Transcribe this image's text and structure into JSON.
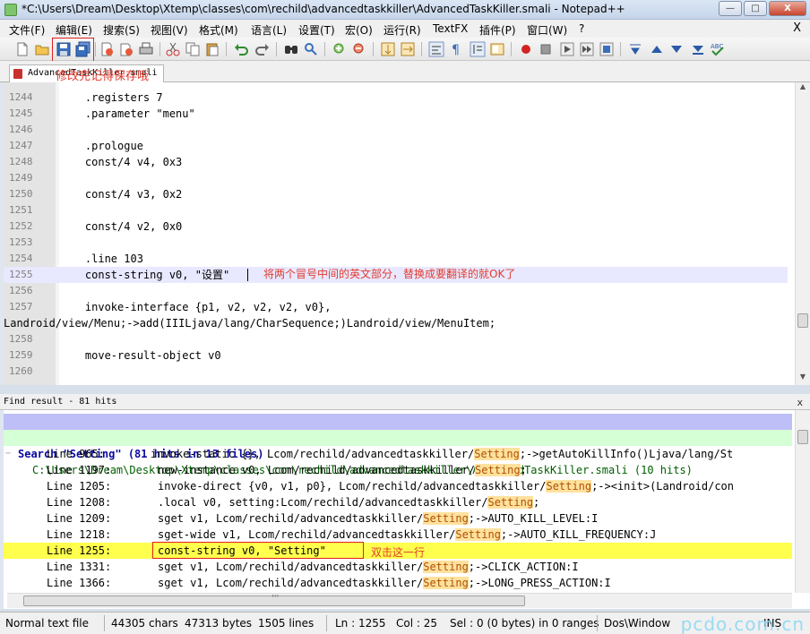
{
  "window": {
    "title": "*C:\\Users\\Dream\\Desktop\\Xtemp\\classes\\com\\rechild\\advancedtaskkiller\\AdvancedTaskKiller.smali - Notepad++",
    "minimize": "—",
    "maximize": "□",
    "close": "X"
  },
  "menu": {
    "items": [
      "文件(F)",
      "编辑(E)",
      "搜索(S)",
      "视图(V)",
      "格式(M)",
      "语言(L)",
      "设置(T)",
      "宏(O)",
      "运行(R)",
      "TextFX",
      "插件(P)",
      "窗口(W)",
      "?"
    ],
    "close": "X"
  },
  "toolbar": {
    "icons": [
      "new-file-icon",
      "open-file-icon",
      "save-icon",
      "save-all-icon",
      "close-icon",
      "close-all-icon",
      "print-icon",
      "cut-icon",
      "copy-icon",
      "paste-icon",
      "undo-icon",
      "redo-icon",
      "find-icon",
      "replace-icon",
      "zoom-in-icon",
      "zoom-out-icon",
      "sync-v-icon",
      "sync-h-icon",
      "word-wrap-icon",
      "show-all-icon",
      "indent-guide-icon",
      "doc-map-icon",
      "record-macro-icon",
      "stop-macro-icon",
      "play-macro-icon",
      "run-macro-icon",
      "save-macro-icon",
      "trim-icon",
      "up-icon",
      "down-icon",
      "sort-icon",
      "spellcheck-icon"
    ]
  },
  "tab": {
    "label": "AdvancedTaskKiller.smali",
    "annotation": "修改完记得保存哦"
  },
  "editor": {
    "lines": [
      {
        "num": "1244",
        "code": "    .registers 7"
      },
      {
        "num": "1245",
        "code": "    .parameter \"menu\""
      },
      {
        "num": "1246",
        "code": ""
      },
      {
        "num": "1247",
        "code": "    .prologue"
      },
      {
        "num": "1248",
        "code": "    const/4 v4, 0x3"
      },
      {
        "num": "1249",
        "code": ""
      },
      {
        "num": "1250",
        "code": "    const/4 v3, 0x2"
      },
      {
        "num": "1251",
        "code": ""
      },
      {
        "num": "1252",
        "code": "    const/4 v2, 0x0"
      },
      {
        "num": "1253",
        "code": ""
      },
      {
        "num": "1254",
        "code": "    .line 103"
      },
      {
        "num": "1255",
        "code": "    const-string v0, \"设置\""
      },
      {
        "num": "1256",
        "code": ""
      },
      {
        "num": "1257",
        "code": "    invoke-interface {p1, v2, v2, v2, v0},"
      },
      {
        "num": "",
        "code": "Landroid/view/Menu;->add(IIILjava/lang/CharSequence;)Landroid/view/MenuItem;"
      },
      {
        "num": "1258",
        "code": ""
      },
      {
        "num": "1259",
        "code": "    move-result-object v0"
      },
      {
        "num": "1260",
        "code": ""
      }
    ],
    "annotation": "将两个冒号中间的英文部分，替换成要翻译的就OK了"
  },
  "find": {
    "header": "Find result - 81 hits",
    "close": "x",
    "search_line": "Search \"Setting\" (81 hits in 13 files)",
    "file_line": "C:\\Users\\Dream\\Desktop\\Xtemp\\classes\\com\\rechild\\advancedtaskkiller\\AdvancedTaskKiller.smali (10 hits)",
    "hits": [
      {
        "line": "Line 965:",
        "pre": "invoke-static {}, Lcom/rechild/advancedtaskkiller/",
        "match": "Setting",
        "post": ";->getAutoKillInfo()Ljava/lang/St"
      },
      {
        "line": "Line 1197:",
        "pre": "new-instance v0, Lcom/rechild/advancedtaskkiller/",
        "match": "Setting",
        "post": ";"
      },
      {
        "line": "Line 1205:",
        "pre": "invoke-direct {v0, v1, p0}, Lcom/rechild/advancedtaskkiller/",
        "match": "Setting",
        "post": ";-><init>(Landroid/con"
      },
      {
        "line": "Line 1208:",
        "pre": ".local v0, setting:Lcom/rechild/advancedtaskkiller/",
        "match": "Setting",
        "post": ";"
      },
      {
        "line": "Line 1209:",
        "pre": "sget v1, Lcom/rechild/advancedtaskkiller/",
        "match": "Setting",
        "post": ";->AUTO_KILL_LEVEL:I"
      },
      {
        "line": "Line 1218:",
        "pre": "sget-wide v1, Lcom/rechild/advancedtaskkiller/",
        "match": "Setting",
        "post": ";->AUTO_KILL_FREQUENCY:J"
      },
      {
        "line": "Line 1255:",
        "pre": "const-string v0, \"Setting\"",
        "match": "",
        "post": ""
      },
      {
        "line": "Line 1331:",
        "pre": "sget v1, Lcom/rechild/advancedtaskkiller/",
        "match": "Setting",
        "post": ";->CLICK_ACTION:I"
      },
      {
        "line": "Line 1366:",
        "pre": "sget v1, Lcom/rechild/advancedtaskkiller/",
        "match": "Setting",
        "post": ";->LONG_PRESS_ACTION:I"
      }
    ],
    "annotation": "双击这一行",
    "hscroll_grip": "'''"
  },
  "status": {
    "type": "Normal text file",
    "chars": "44305 chars",
    "bytes": "47313 bytes",
    "lines": "1505 lines",
    "ln": "Ln : 1255",
    "col": "Col : 25",
    "sel": "Sel : 0 (0 bytes) in 0 ranges",
    "eol": "Dos\\Window",
    "enc": "INS",
    "watermark": "pcdo.com.cn"
  },
  "colors": {
    "annotation": "#e23b2e",
    "search_bg": "#bfbff7",
    "file_bg": "#d5ffd5",
    "selected_hit": "#ffff4d",
    "match_hl": "#ffe19e"
  }
}
